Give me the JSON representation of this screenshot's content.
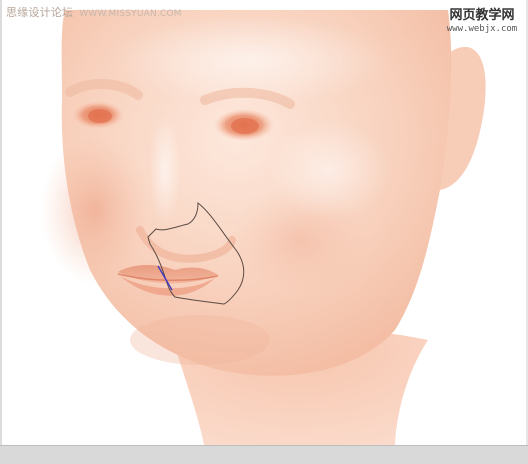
{
  "watermark_left": {
    "text": "思缘设计论坛",
    "url": "WWW.MISSYUAN.COM"
  },
  "watermark_right": {
    "text": "网页教学网",
    "url": "www.webjx.com"
  },
  "colors": {
    "skin_base": "#f7cdb8",
    "skin_light": "#fbe3d6",
    "skin_shadow": "#eea98c",
    "feature": "#e9896a",
    "selection_path": "#5a4a44",
    "path_handle": "#3a36c8",
    "frame": "#d9d9d9"
  },
  "tool": {
    "name": "pen-path",
    "state": "drawing"
  }
}
